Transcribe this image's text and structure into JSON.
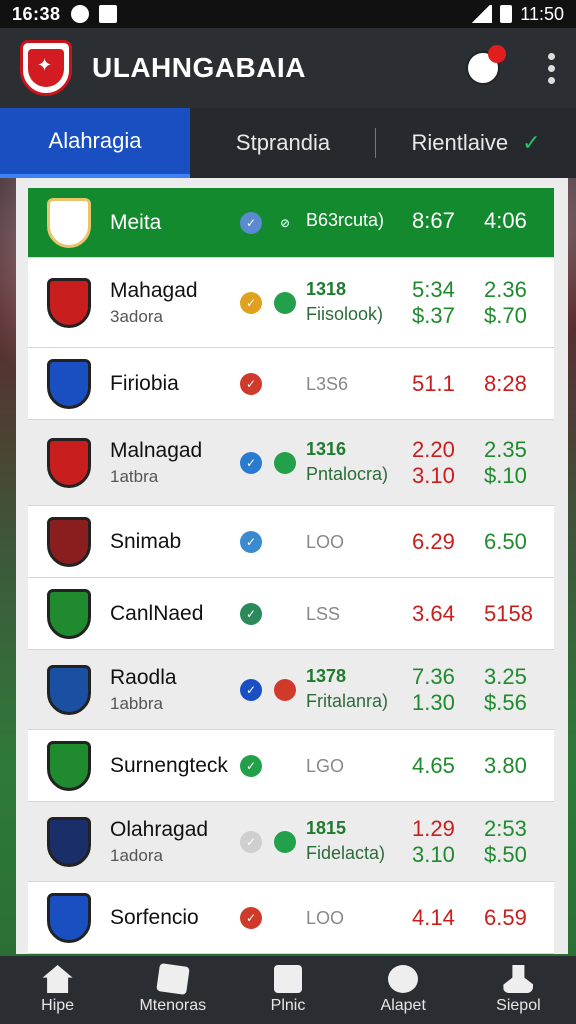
{
  "status": {
    "time_left": "16:38",
    "time_right": "11:50"
  },
  "app": {
    "title": "ULAHNGABAIA"
  },
  "tabs": [
    "Alahragia",
    "Stprandia",
    "Rientlaive"
  ],
  "header_row": {
    "team": "Meita",
    "code": "B63rcuta)",
    "o1": "8:67",
    "o2": "4:06"
  },
  "rows": [
    {
      "team": "Mahagad",
      "sub": "3adora",
      "a": "1318",
      "b": "Fiisolook)",
      "o1": [
        "5:34",
        "$.37"
      ],
      "o2": [
        "2.36",
        "$.70"
      ],
      "o1c": [
        "green",
        "green"
      ],
      "o2c": [
        "green",
        "green"
      ],
      "ic1": "#e0a020",
      "ic2": "#22a04a",
      "alt": false,
      "crest": "#c81e1e"
    },
    {
      "team": "Firiobia",
      "sub": "",
      "a": "L3S6",
      "b": "",
      "o1": [
        "51.1"
      ],
      "o2": [
        "8:28"
      ],
      "o1c": [
        "red"
      ],
      "o2c": [
        "red"
      ],
      "ic1": "#d03a2a",
      "ic2": "",
      "alt": false,
      "crest": "#1a4fc2",
      "grey": true
    },
    {
      "team": "Malnagad",
      "sub": "1atbra",
      "a": "1316",
      "b": "Pntalocra)",
      "o1": [
        "2.20",
        "3.10"
      ],
      "o2": [
        "2.35",
        "$.10"
      ],
      "o1c": [
        "red",
        "red"
      ],
      "o2c": [
        "green",
        "green"
      ],
      "ic1": "#2a7ad0",
      "ic2": "#22a04a",
      "alt": true,
      "crest": "#c81e1e"
    },
    {
      "team": "Snimab",
      "sub": "",
      "a": "LOO",
      "b": "",
      "o1": [
        "6.29"
      ],
      "o2": [
        "6.50"
      ],
      "o1c": [
        "red"
      ],
      "o2c": [
        "green"
      ],
      "ic1": "#3a8ad0",
      "ic2": "",
      "alt": false,
      "crest": "#8a1e1e",
      "grey": true
    },
    {
      "team": "CanlNaed",
      "sub": "",
      "a": "LSS",
      "b": "",
      "o1": [
        "3.64"
      ],
      "o2": [
        "5158"
      ],
      "o1c": [
        "red"
      ],
      "o2c": [
        "red"
      ],
      "ic1": "#2a8a5a",
      "ic2": "",
      "alt": false,
      "crest": "#1f8a2e",
      "grey": true
    },
    {
      "team": "Raodla",
      "sub": "1abbra",
      "a": "1378",
      "b": "Fritalanra)",
      "o1": [
        "7.36",
        "1.30"
      ],
      "o2": [
        "3.25",
        "$.56"
      ],
      "o1c": [
        "green",
        "green"
      ],
      "o2c": [
        "green",
        "green"
      ],
      "ic1": "#1a4fc2",
      "ic2": "#d03a2a",
      "alt": true,
      "crest": "#1a4fa2"
    },
    {
      "team": "Surnengteck",
      "sub": "",
      "a": "LGO",
      "b": "",
      "o1": [
        "4.65"
      ],
      "o2": [
        "3.80"
      ],
      "o1c": [
        "green"
      ],
      "o2c": [
        "green"
      ],
      "ic1": "#22a04a",
      "ic2": "",
      "alt": false,
      "crest": "#1f8a2e",
      "grey": true
    },
    {
      "team": "Olahragad",
      "sub": "1adora",
      "a": "1815",
      "b": "Fidelacta)",
      "o1": [
        "1.29",
        "3.10"
      ],
      "o2": [
        "2:53",
        "$.50"
      ],
      "o1c": [
        "red",
        "green"
      ],
      "o2c": [
        "green",
        "green"
      ],
      "ic1": "#cfcfcf",
      "ic2": "#22a04a",
      "alt": true,
      "crest": "#1a2f6a"
    },
    {
      "team": "Sorfencio",
      "sub": "",
      "a": "LOO",
      "b": "",
      "o1": [
        "4.14"
      ],
      "o2": [
        "6.59"
      ],
      "o1c": [
        "red"
      ],
      "o2c": [
        "red"
      ],
      "ic1": "#d03a2a",
      "ic2": "",
      "alt": false,
      "crest": "#1a4fc2",
      "grey": true
    }
  ],
  "nav": [
    "Hipe",
    "Mtenoras",
    "Plnic",
    "Alapet",
    "Siepol"
  ]
}
